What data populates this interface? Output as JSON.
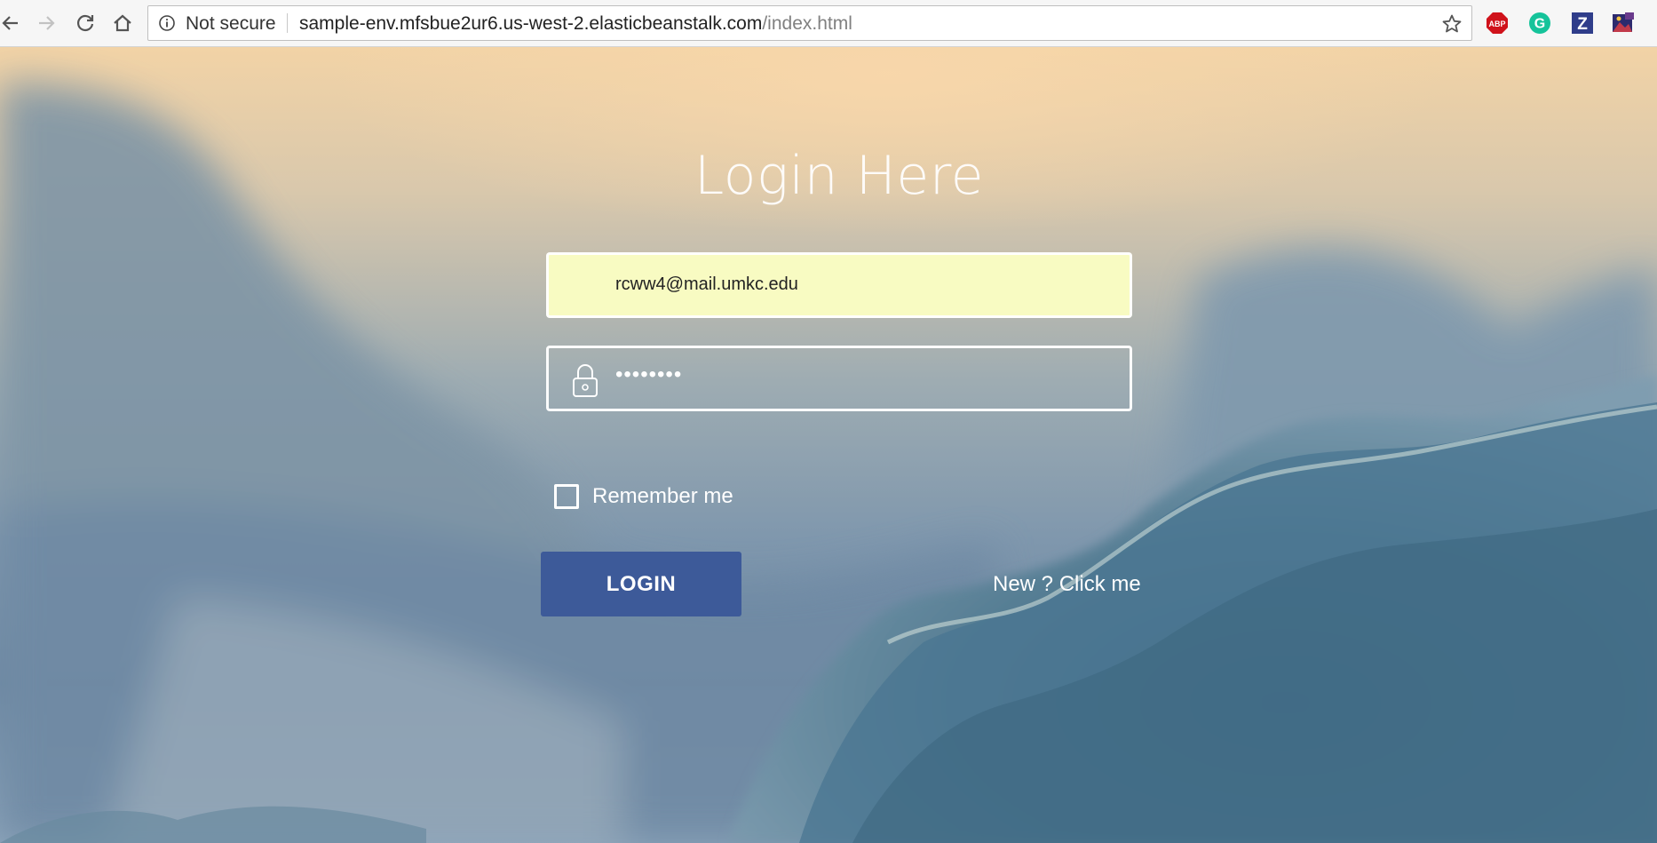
{
  "browser": {
    "security_label": "Not secure",
    "url_host": "sample-env.mfsbue2ur6.us-west-2.elasticbeanstalk.com",
    "url_path": "/index.html",
    "extensions": [
      {
        "name": "adblock-plus",
        "label": "ABP",
        "color": "#d0121b"
      },
      {
        "name": "grammarly",
        "label": "G",
        "color": "#15c39a"
      },
      {
        "name": "zotero",
        "label": "Z",
        "color": "#2f3d8a"
      },
      {
        "name": "image-extension",
        "label": "",
        "color": "#6a3a8c"
      }
    ]
  },
  "login": {
    "title": "Login Here",
    "email_value": "rcww4@mail.umkc.edu",
    "password_value": "••••••••",
    "remember_label": "Remember me",
    "remember_checked": false,
    "login_button": "LOGIN",
    "signup_link": "New ? Click me"
  },
  "colors": {
    "button": "#3d5a99",
    "autofill": "#f8fbc2"
  }
}
